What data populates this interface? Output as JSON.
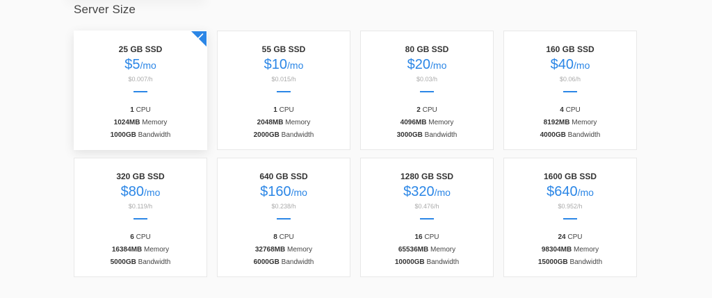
{
  "section": {
    "title": "Server Size"
  },
  "plans": [
    {
      "storage": "25 GB SSD",
      "price": "$5",
      "unit": "/mo",
      "hourly": "$0.007/h",
      "cpu": "1",
      "cpu_label": "CPU",
      "memory": "1024MB",
      "memory_label": "Memory",
      "bandwidth": "1000GB",
      "bandwidth_label": "Bandwidth",
      "selected": true
    },
    {
      "storage": "55 GB SSD",
      "price": "$10",
      "unit": "/mo",
      "hourly": "$0.015/h",
      "cpu": "1",
      "cpu_label": "CPU",
      "memory": "2048MB",
      "memory_label": "Memory",
      "bandwidth": "2000GB",
      "bandwidth_label": "Bandwidth",
      "selected": false
    },
    {
      "storage": "80 GB SSD",
      "price": "$20",
      "unit": "/mo",
      "hourly": "$0.03/h",
      "cpu": "2",
      "cpu_label": "CPU",
      "memory": "4096MB",
      "memory_label": "Memory",
      "bandwidth": "3000GB",
      "bandwidth_label": "Bandwidth",
      "selected": false
    },
    {
      "storage": "160 GB SSD",
      "price": "$40",
      "unit": "/mo",
      "hourly": "$0.06/h",
      "cpu": "4",
      "cpu_label": "CPU",
      "memory": "8192MB",
      "memory_label": "Memory",
      "bandwidth": "4000GB",
      "bandwidth_label": "Bandwidth",
      "selected": false
    },
    {
      "storage": "320 GB SSD",
      "price": "$80",
      "unit": "/mo",
      "hourly": "$0.119/h",
      "cpu": "6",
      "cpu_label": "CPU",
      "memory": "16384MB",
      "memory_label": "Memory",
      "bandwidth": "5000GB",
      "bandwidth_label": "Bandwidth",
      "selected": false
    },
    {
      "storage": "640 GB SSD",
      "price": "$160",
      "unit": "/mo",
      "hourly": "$0.238/h",
      "cpu": "8",
      "cpu_label": "CPU",
      "memory": "32768MB",
      "memory_label": "Memory",
      "bandwidth": "6000GB",
      "bandwidth_label": "Bandwidth",
      "selected": false
    },
    {
      "storage": "1280 GB SSD",
      "price": "$320",
      "unit": "/mo",
      "hourly": "$0.476/h",
      "cpu": "16",
      "cpu_label": "CPU",
      "memory": "65536MB",
      "memory_label": "Memory",
      "bandwidth": "10000GB",
      "bandwidth_label": "Bandwidth",
      "selected": false
    },
    {
      "storage": "1600 GB SSD",
      "price": "$640",
      "unit": "/mo",
      "hourly": "$0.952/h",
      "cpu": "24",
      "cpu_label": "CPU",
      "memory": "98304MB",
      "memory_label": "Memory",
      "bandwidth": "15000GB",
      "bandwidth_label": "Bandwidth",
      "selected": false
    }
  ],
  "icons": {
    "selected": "checkmark-icon"
  },
  "colors": {
    "accent": "#2b86e6",
    "muted": "#aaaaaa",
    "text": "#333333"
  }
}
